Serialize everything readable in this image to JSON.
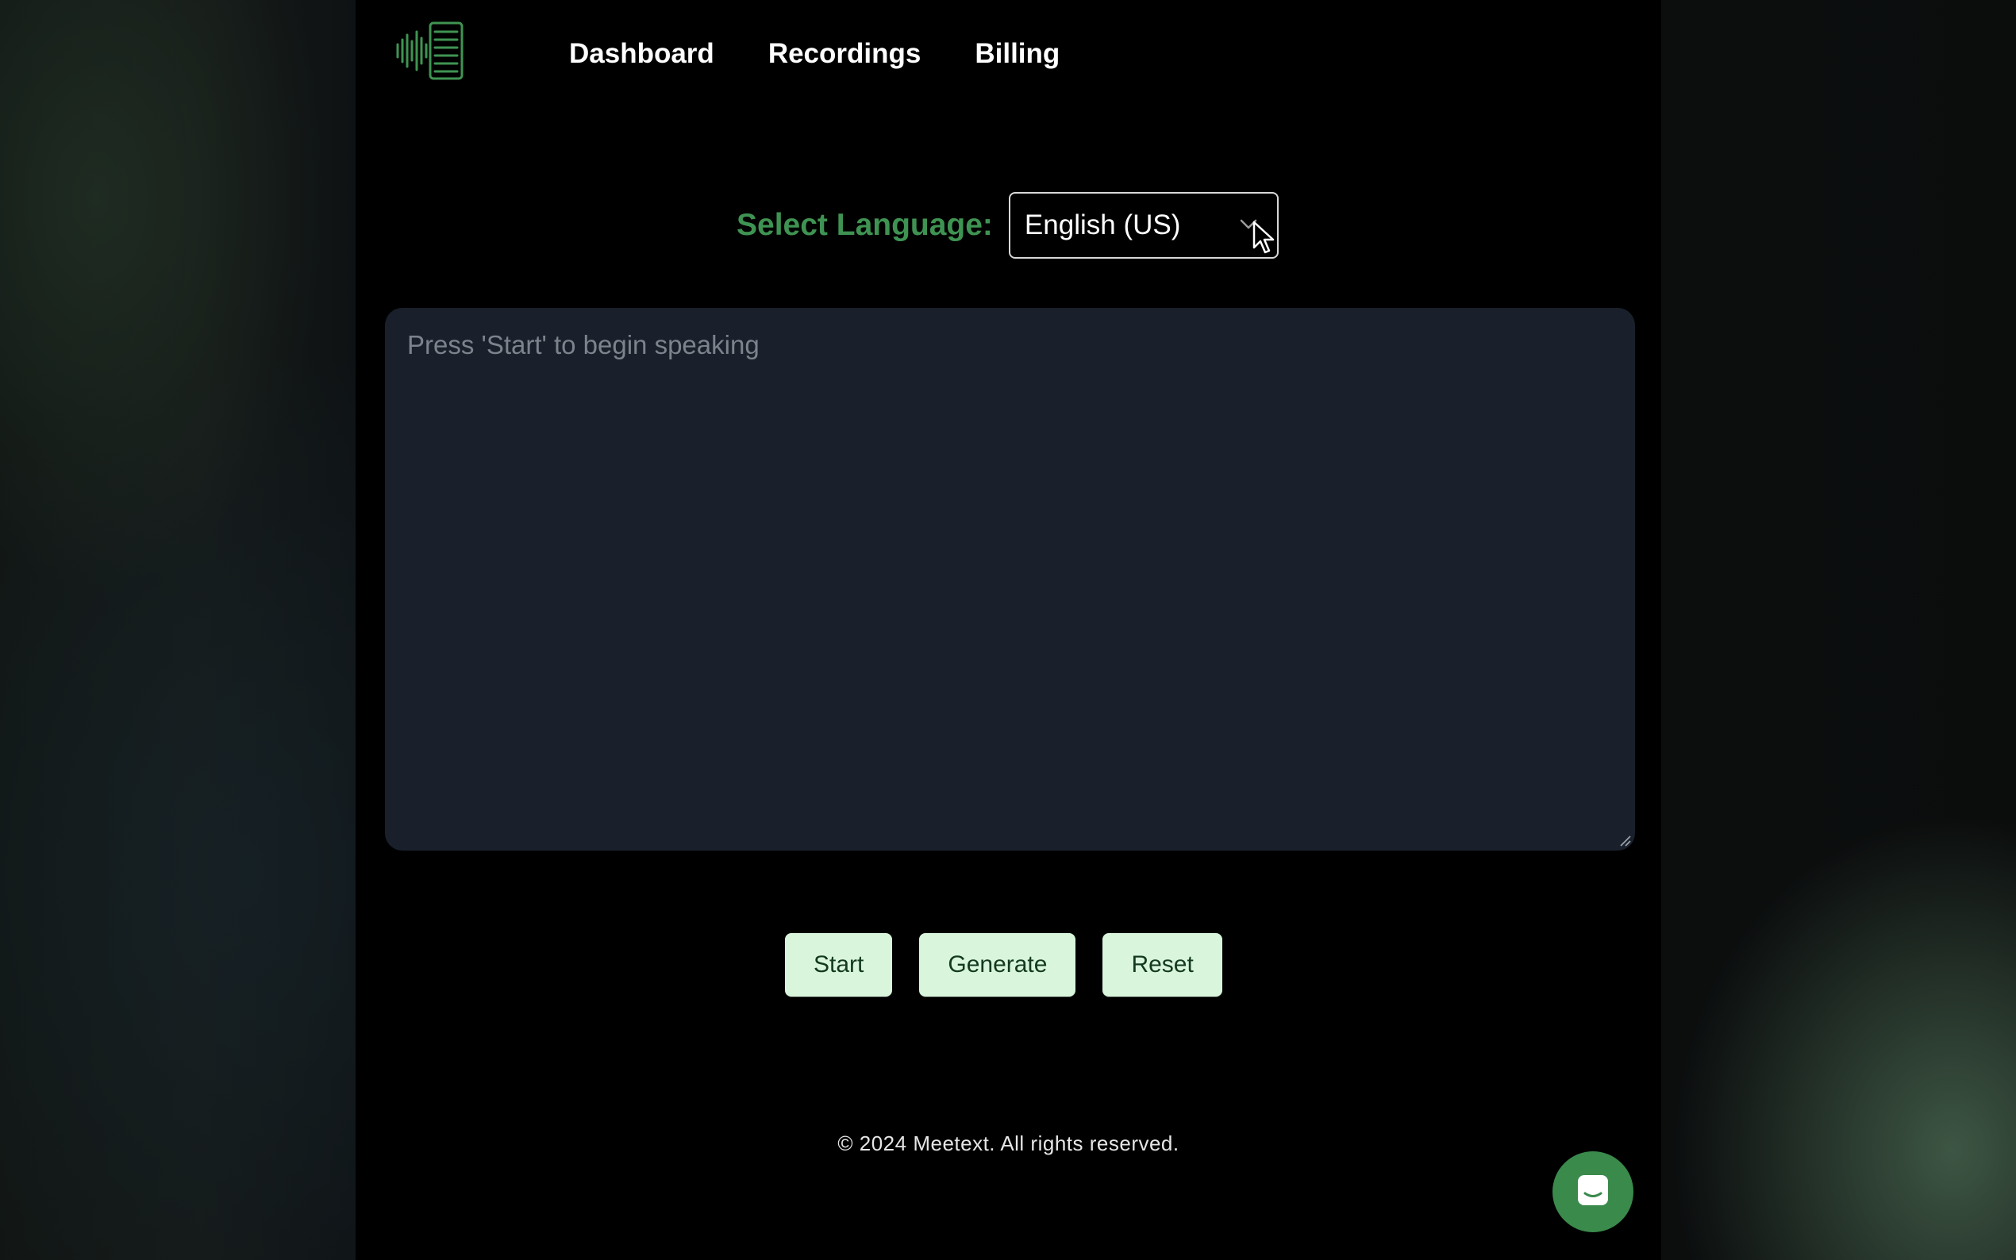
{
  "brand": {
    "logo_icon": "waveform-document-logo",
    "accent_color": "#3f9352"
  },
  "nav": {
    "items": [
      {
        "label": "Dashboard"
      },
      {
        "label": "Recordings"
      },
      {
        "label": "Billing"
      }
    ]
  },
  "language": {
    "label": "Select Language:",
    "selected": "English (US)"
  },
  "transcript": {
    "placeholder": "Press 'Start' to begin speaking"
  },
  "actions": {
    "start_label": "Start",
    "generate_label": "Generate",
    "reset_label": "Reset"
  },
  "footer": {
    "copyright": "© 2024 Meetext. All rights reserved."
  },
  "chat": {
    "icon": "chat-bubble-icon",
    "color": "#3a8a4c"
  }
}
